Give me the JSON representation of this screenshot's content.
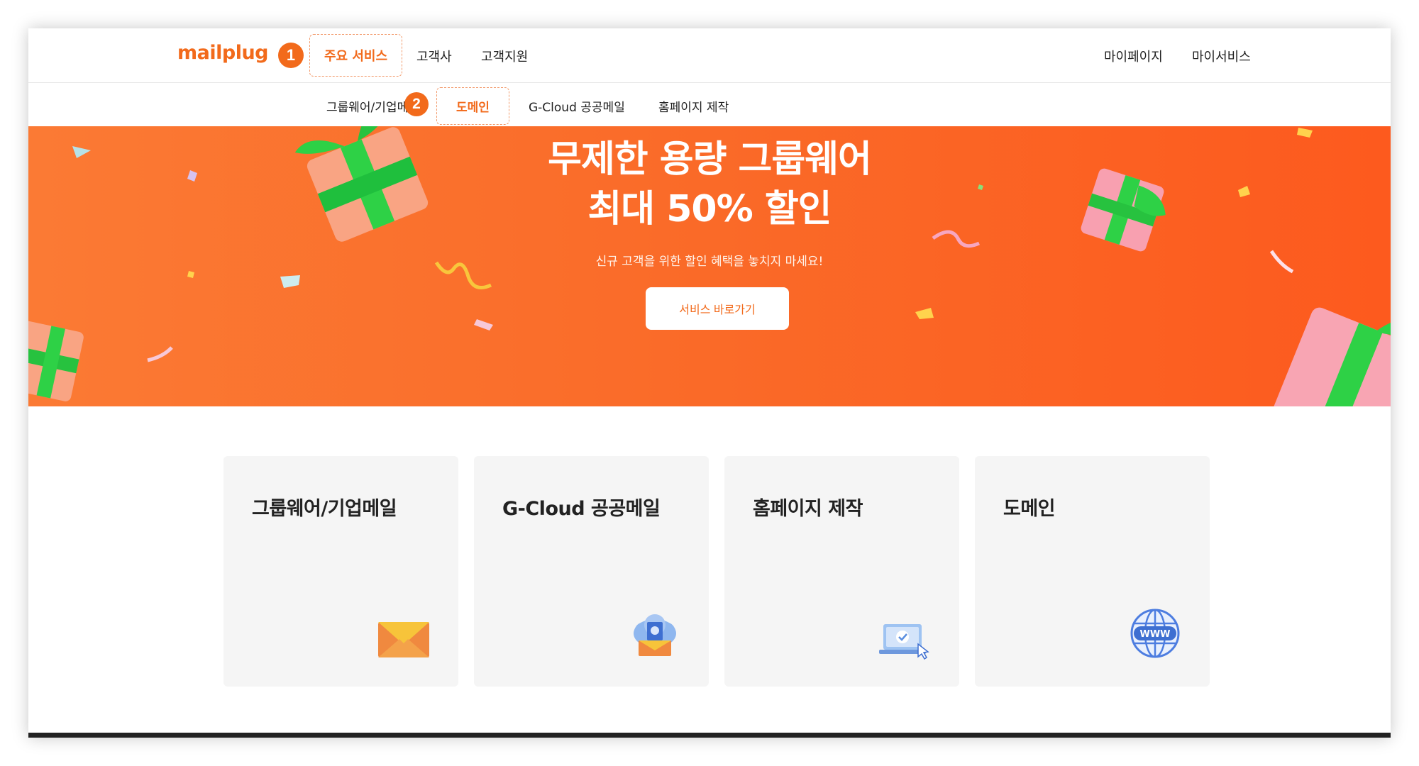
{
  "header": {
    "logo": "mailplug",
    "step1": "1",
    "main_services": "주요 서비스",
    "customers": "고객사",
    "support": "고객지원",
    "mypage": "마이페이지",
    "myservice": "마이서비스"
  },
  "subnav": {
    "groupware": "그룹웨어/기업메",
    "step2": "2",
    "domain": "도메인",
    "gcloud": "G-Cloud 공공메일",
    "homepage": "홈페이지 제작"
  },
  "banner": {
    "title_line1": "무제한 용량 그룹웨어",
    "title_line2": "최대 50% 할인",
    "subtitle": "신규 고객을 위한 할인 혜택을 놓치지 마세요!",
    "button": "서비스 바로가기"
  },
  "cards": [
    {
      "title": "그룹웨어/기업메일",
      "icon": "envelope-icon"
    },
    {
      "title": "G-Cloud 공공메일",
      "icon": "cloud-mail-icon"
    },
    {
      "title": "홈페이지 제작",
      "icon": "laptop-icon"
    },
    {
      "title": "도메인",
      "icon": "globe-www-icon"
    }
  ],
  "globe_label": "WWW",
  "colors": {
    "accent": "#f26a1b",
    "banner_start": "#fb7a34",
    "banner_end": "#fd5a1e",
    "card_bg": "#f5f5f5"
  }
}
